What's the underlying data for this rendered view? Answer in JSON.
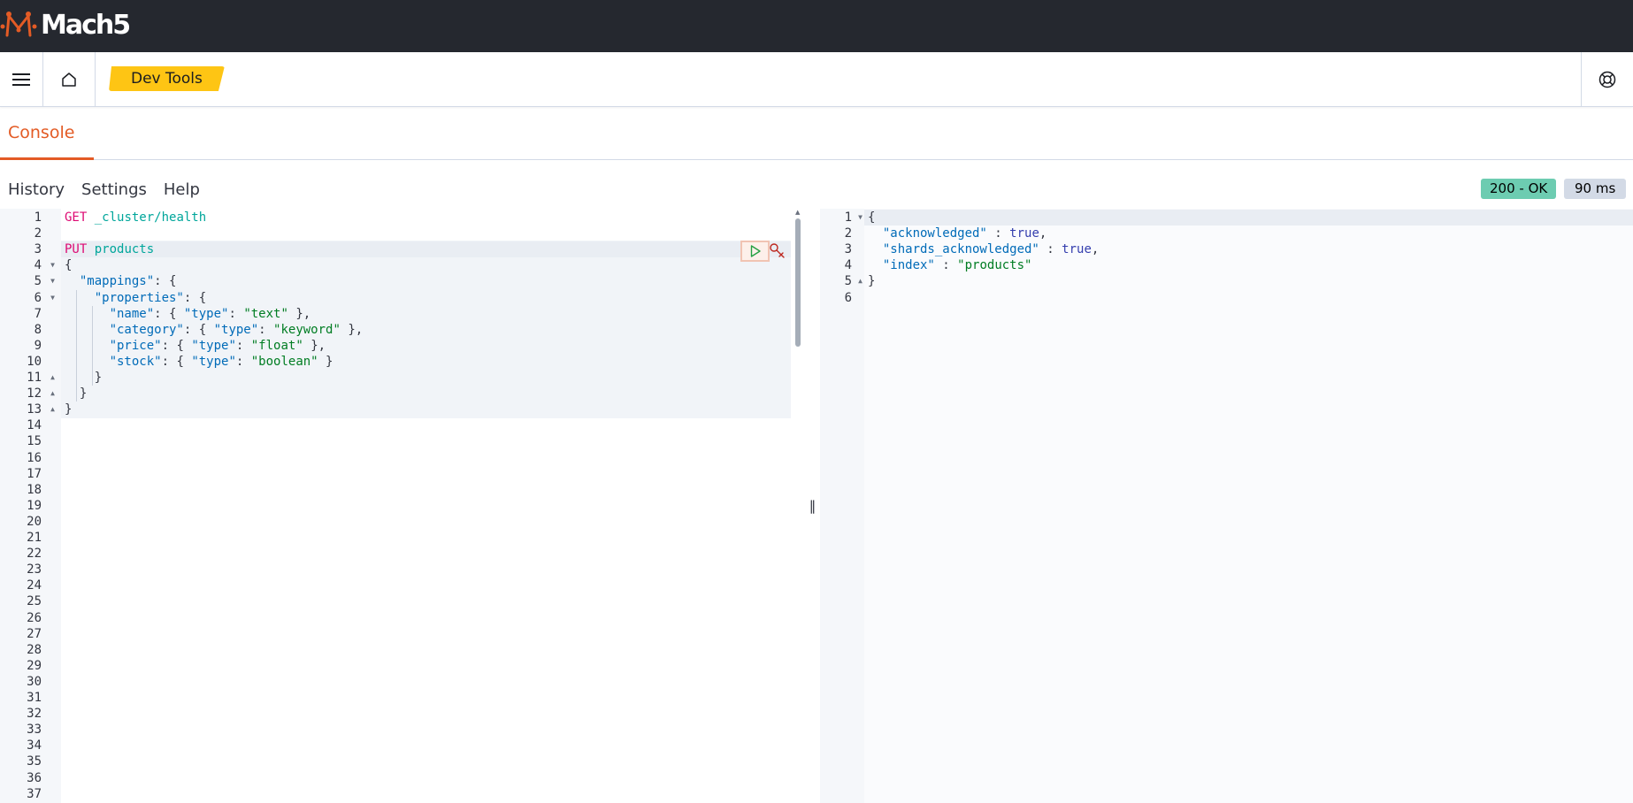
{
  "app": {
    "logo_text": "Mach5",
    "breadcrumb": "Dev Tools"
  },
  "tabs": [
    {
      "label": "Console",
      "active": true
    }
  ],
  "console_menu": {
    "history": "History",
    "settings": "Settings",
    "help": "Help"
  },
  "response_status": {
    "status": "200 - OK",
    "time": "90 ms",
    "status_color": "#6dccb1"
  },
  "request_editor": {
    "line_count": 37,
    "lines": [
      [
        [
          "kw-method",
          "GET"
        ],
        [
          "tok-punc",
          " "
        ],
        [
          "kw-url",
          "_cluster/health"
        ]
      ],
      [],
      [
        [
          "kw-method",
          "PUT"
        ],
        [
          "tok-punc",
          " "
        ],
        [
          "kw-url",
          "products"
        ]
      ],
      [
        [
          "tok-punc",
          "{"
        ]
      ],
      [
        [
          "tok-punc",
          "  "
        ],
        [
          "tok-key",
          "\"mappings\""
        ],
        [
          "tok-punc",
          ": {"
        ]
      ],
      [
        [
          "tok-punc",
          "    "
        ],
        [
          "tok-key",
          "\"properties\""
        ],
        [
          "tok-punc",
          ": {"
        ]
      ],
      [
        [
          "tok-punc",
          "      "
        ],
        [
          "tok-key",
          "\"name\""
        ],
        [
          "tok-punc",
          ": { "
        ],
        [
          "tok-key",
          "\"type\""
        ],
        [
          "tok-punc",
          ": "
        ],
        [
          "tok-str",
          "\"text\""
        ],
        [
          "tok-punc",
          " },"
        ]
      ],
      [
        [
          "tok-punc",
          "      "
        ],
        [
          "tok-key",
          "\"category\""
        ],
        [
          "tok-punc",
          ": { "
        ],
        [
          "tok-key",
          "\"type\""
        ],
        [
          "tok-punc",
          ": "
        ],
        [
          "tok-str",
          "\"keyword\""
        ],
        [
          "tok-punc",
          " },"
        ]
      ],
      [
        [
          "tok-punc",
          "      "
        ],
        [
          "tok-key",
          "\"price\""
        ],
        [
          "tok-punc",
          ": { "
        ],
        [
          "tok-key",
          "\"type\""
        ],
        [
          "tok-punc",
          ": "
        ],
        [
          "tok-str",
          "\"float\""
        ],
        [
          "tok-punc",
          " },"
        ]
      ],
      [
        [
          "tok-punc",
          "      "
        ],
        [
          "tok-key",
          "\"stock\""
        ],
        [
          "tok-punc",
          ": { "
        ],
        [
          "tok-key",
          "\"type\""
        ],
        [
          "tok-punc",
          ": "
        ],
        [
          "tok-str",
          "\"boolean\""
        ],
        [
          "tok-punc",
          " }"
        ]
      ],
      [
        [
          "tok-punc",
          "    }"
        ]
      ],
      [
        [
          "tok-punc",
          "  }"
        ]
      ],
      [
        [
          "tok-punc",
          "}"
        ]
      ]
    ]
  },
  "response_editor": {
    "line_count": 6,
    "lines": [
      [
        [
          "tok-punc",
          "{"
        ]
      ],
      [
        [
          "tok-punc",
          "  "
        ],
        [
          "tok-key",
          "\"acknowledged\""
        ],
        [
          "tok-punc",
          " : "
        ],
        [
          "tok-bool",
          "true"
        ],
        [
          "tok-punc",
          ","
        ]
      ],
      [
        [
          "tok-punc",
          "  "
        ],
        [
          "tok-key",
          "\"shards_acknowledged\""
        ],
        [
          "tok-punc",
          " : "
        ],
        [
          "tok-bool",
          "true"
        ],
        [
          "tok-punc",
          ","
        ]
      ],
      [
        [
          "tok-punc",
          "  "
        ],
        [
          "tok-key",
          "\"index\""
        ],
        [
          "tok-punc",
          " : "
        ],
        [
          "tok-str",
          "\"products\""
        ]
      ],
      [
        [
          "tok-punc",
          "}"
        ]
      ],
      []
    ]
  },
  "colors": {
    "header_bg": "#25282f",
    "accent": "#e35b25",
    "breadcrumb_bg": "#fec514"
  }
}
